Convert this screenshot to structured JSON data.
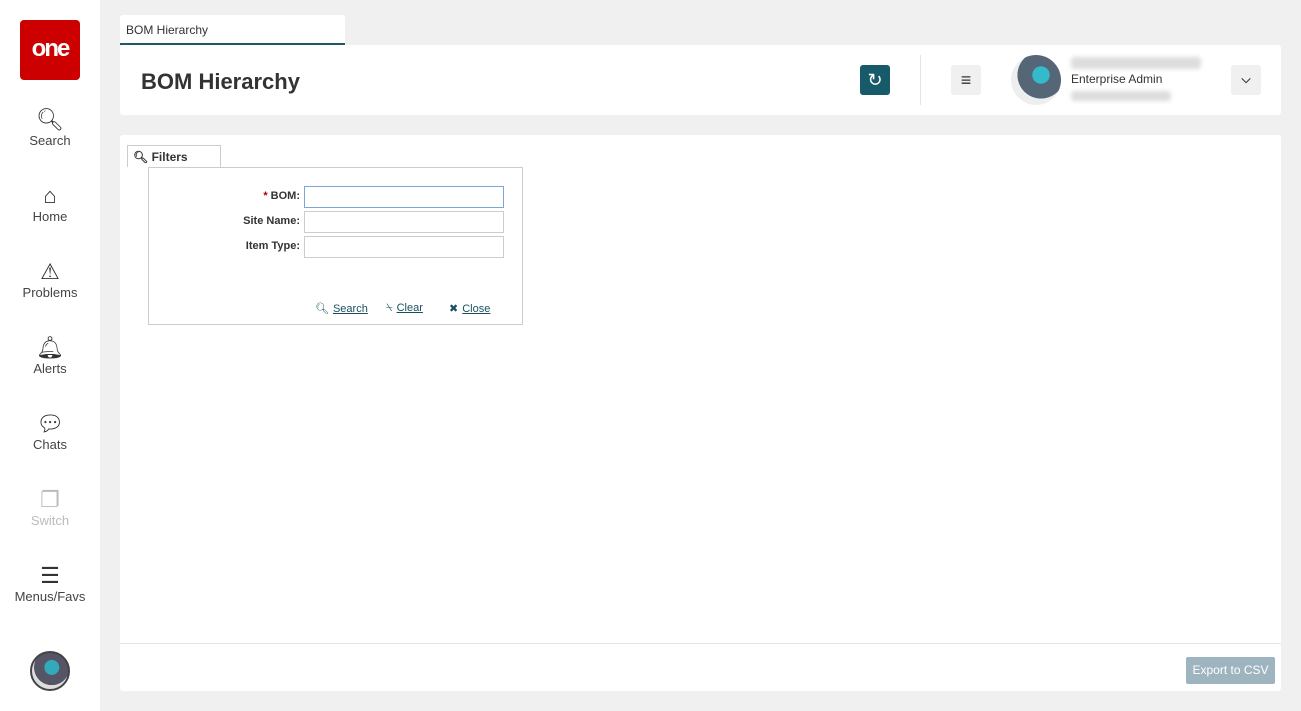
{
  "sidebar": {
    "logo": "one",
    "items": [
      {
        "label": "Search",
        "icon": "search-icon"
      },
      {
        "label": "Home",
        "icon": "home-icon"
      },
      {
        "label": "Problems",
        "icon": "warning-icon"
      },
      {
        "label": "Alerts",
        "icon": "bell-icon"
      },
      {
        "label": "Chats",
        "icon": "chat-icon"
      },
      {
        "label": "Switch",
        "icon": "switch-icon",
        "disabled": true
      },
      {
        "label": "Menus/Favs",
        "icon": "menu-icon"
      }
    ]
  },
  "tab": {
    "label": "BOM Hierarchy"
  },
  "header": {
    "title": "BOM Hierarchy",
    "user_role": "Enterprise Admin"
  },
  "filters": {
    "tab_label": "Filters",
    "fields": [
      {
        "label": "BOM:",
        "required": "*",
        "value": ""
      },
      {
        "label": "Site Name:",
        "value": ""
      },
      {
        "label": "Item Type:",
        "value": ""
      }
    ],
    "actions": {
      "search": "Search",
      "clear": "Clear",
      "close": "Close"
    }
  },
  "footer": {
    "export": "Export to CSV"
  },
  "colors": {
    "accent": "#175b6b",
    "logo": "#cc0000"
  }
}
